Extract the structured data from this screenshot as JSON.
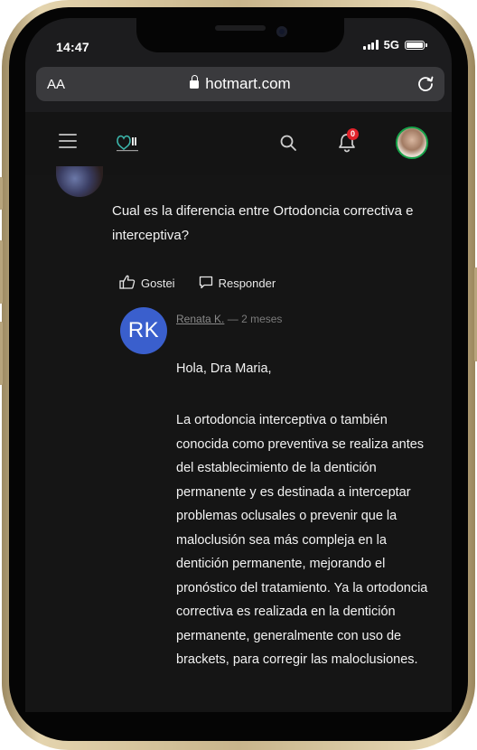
{
  "status_bar": {
    "time": "14:47",
    "network": "5G"
  },
  "browser": {
    "text_size_label": "AA",
    "domain": "hotmart.com"
  },
  "header": {
    "notification_count": "0",
    "icons": [
      "menu-icon",
      "search-icon",
      "bell-icon"
    ]
  },
  "parent_comment": {
    "text": "Cual es la diferencia entre Ortodoncia correctiva e interceptiva?",
    "like_label": "Gostei",
    "reply_label": "Responder"
  },
  "reply": {
    "initials": "RK",
    "author": "Renata K.",
    "separator": "—",
    "time_ago": "2 meses",
    "greeting": "Hola, Dra Maria,",
    "body": "La ortodoncia interceptiva o también conocida como preventiva se realiza antes del establecimiento de la dentición permanente y es destinada a interceptar problemas oclusales o prevenir que la maloclusión sea más compleja en la dentición permanente, mejorando el pronóstico del tratamiento. Ya la ortodoncia correctiva es realizada en la dentición permanente, generalmente con uso de brackets, para corregir las maloclusiones."
  },
  "colors": {
    "avatar_bg": "#3a5fcd",
    "badge": "#e0232b",
    "user_ring": "#17a34a"
  }
}
